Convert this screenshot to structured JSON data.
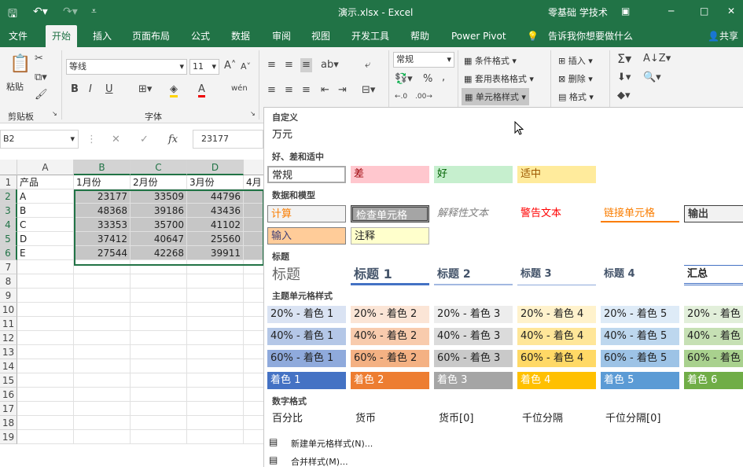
{
  "title_bar": {
    "filename": "演示.xlsx",
    "app": "Excel",
    "user": "零基础 学技术",
    "minimize": "─",
    "restore": "□",
    "close": "✕"
  },
  "tabs": [
    "文件",
    "开始",
    "插入",
    "页面布局",
    "公式",
    "数据",
    "审阅",
    "视图",
    "开发工具",
    "帮助",
    "Power Pivot"
  ],
  "tell_me": "告诉我你想要做什么",
  "share": "共享",
  "ribbon": {
    "paste": "粘贴",
    "clipboard": "剪贴板",
    "font_name": "等线",
    "font_size": "11",
    "font_group": "字体",
    "bold": "B",
    "italic": "I",
    "underline": "U",
    "number_format": "常规",
    "percent": "%",
    "cond_format": "条件格式",
    "table_format": "套用表格格式",
    "cell_styles": "单元格样式",
    "insert": "插入",
    "delete": "删除",
    "format": "格式"
  },
  "formula_bar": {
    "name_box": "B2",
    "value": "23177",
    "fx": "fx"
  },
  "sheet": {
    "columns": [
      "A",
      "B",
      "C",
      "D",
      "4月"
    ],
    "rows": [
      "1",
      "2",
      "3",
      "4",
      "5",
      "6",
      "7",
      "8",
      "9",
      "10",
      "11",
      "12",
      "13",
      "14",
      "15",
      "16",
      "17",
      "18",
      "19"
    ],
    "header": [
      "产品",
      "1月份",
      "2月份",
      "3月份",
      "4月"
    ],
    "data": [
      [
        "A",
        "23177",
        "33509",
        "44796"
      ],
      [
        "B",
        "48368",
        "39186",
        "43436"
      ],
      [
        "C",
        "33353",
        "35700",
        "41102"
      ],
      [
        "D",
        "37412",
        "40647",
        "25560"
      ],
      [
        "E",
        "27544",
        "42268",
        "39911"
      ]
    ]
  },
  "gallery": {
    "custom_header": "自定义",
    "custom_item": "万元",
    "good_bad_header": "好、差和适中",
    "good_bad": [
      "常规",
      "差",
      "好",
      "适中"
    ],
    "data_model_header": "数据和模型",
    "data_model_row1": [
      "计算",
      "检查单元格",
      "解释性文本",
      "警告文本",
      "链接单元格",
      "输出"
    ],
    "data_model_row2": [
      "输入",
      "注释"
    ],
    "titles_header": "标题",
    "titles": [
      "标题",
      "标题 1",
      "标题 2",
      "标题 3",
      "标题 4",
      "汇总"
    ],
    "theme_header": "主题单元格样式",
    "theme_rows": [
      [
        "20% - 着色 1",
        "20% - 着色 2",
        "20% - 着色 3",
        "20% - 着色 4",
        "20% - 着色 5",
        "20% - 着色 6"
      ],
      [
        "40% - 着色 1",
        "40% - 着色 2",
        "40% - 着色 3",
        "40% - 着色 4",
        "40% - 着色 5",
        "40% - 着色 6"
      ],
      [
        "60% - 着色 1",
        "60% - 着色 2",
        "60% - 着色 3",
        "60% - 着色 4",
        "60% - 着色 5",
        "60% - 着色 6"
      ],
      [
        "着色 1",
        "着色 2",
        "着色 3",
        "着色 4",
        "着色 5",
        "着色 6"
      ]
    ],
    "number_header": "数字格式",
    "number_formats": [
      "百分比",
      "货币",
      "货币[0]",
      "千位分隔",
      "千位分隔[0]"
    ],
    "new_style": "新建单元格样式(N)...",
    "merge_style": "合并样式(M)..."
  },
  "colors": {
    "accent": "#217346",
    "selection": "#c6c6c6"
  }
}
